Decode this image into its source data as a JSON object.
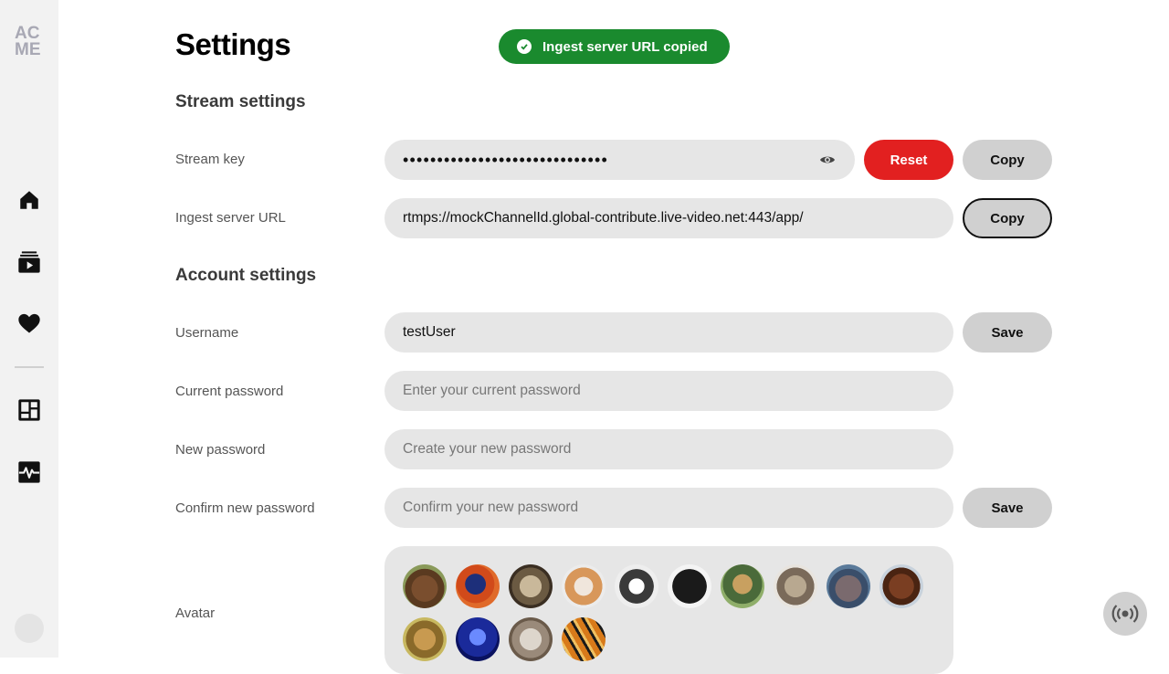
{
  "sidebar": {
    "logo_line1": "AC",
    "logo_line2": "ME",
    "nav": [
      {
        "name": "home-icon"
      },
      {
        "name": "video-library-icon"
      },
      {
        "name": "heart-icon"
      },
      {
        "name": "dashboard-icon"
      },
      {
        "name": "activity-icon"
      }
    ]
  },
  "page": {
    "title": "Settings"
  },
  "toast": {
    "text": "Ingest server URL copied",
    "color": "#1a8a2e"
  },
  "stream": {
    "section_title": "Stream settings",
    "key_label": "Stream key",
    "key_value": "••••••••••••••••••••••••••••••",
    "reset_label": "Reset",
    "copy_key_label": "Copy",
    "ingest_label": "Ingest server URL",
    "ingest_value": "rtmps://mockChannelId.global-contribute.live-video.net:443/app/",
    "copy_ingest_label": "Copy"
  },
  "account": {
    "section_title": "Account settings",
    "username_label": "Username",
    "username_value": "testUser",
    "save_username_label": "Save",
    "current_pw_label": "Current password",
    "current_pw_placeholder": "Enter your current password",
    "new_pw_label": "New password",
    "new_pw_placeholder": "Create your new password",
    "confirm_pw_label": "Confirm new password",
    "confirm_pw_placeholder": "Confirm your new password",
    "save_password_label": "Save",
    "avatar_label": "Avatar",
    "avatars": [
      "bear",
      "parrot",
      "owl",
      "shiba",
      "pitbull",
      "pug",
      "giraffe",
      "hedgehog",
      "hippo",
      "horse",
      "gazelle",
      "jellyfish",
      "sheep",
      "tiger"
    ]
  },
  "colors": {
    "accent_red": "#e22020",
    "success_green": "#1a8a2e",
    "field_bg": "#e6e6e6"
  }
}
